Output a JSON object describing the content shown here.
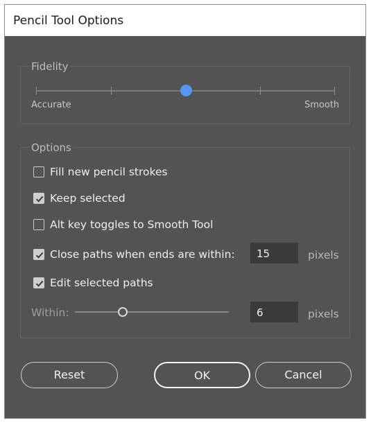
{
  "dialog": {
    "title": "Pencil Tool Options"
  },
  "fidelity": {
    "group_label": "Fidelity",
    "left_label": "Accurate",
    "right_label": "Smooth",
    "position_fraction": 0.5,
    "ticks": 5,
    "accent_color": "#5597ee"
  },
  "options": {
    "group_label": "Options",
    "fill_new": {
      "label": "Fill new pencil strokes",
      "checked": false
    },
    "keep_selected": {
      "label": "Keep selected",
      "checked": true
    },
    "alt_toggle": {
      "label": "Alt key toggles to Smooth Tool",
      "checked": false
    },
    "close_paths": {
      "label": "Close paths when ends are within:",
      "checked": true,
      "value": "15",
      "unit": "pixels"
    },
    "edit_selected": {
      "label": "Edit selected paths",
      "checked": true
    },
    "within": {
      "label": "Within:",
      "value": "6",
      "unit": "pixels",
      "slider_fraction": 0.3
    }
  },
  "buttons": {
    "reset": "Reset",
    "ok": "OK",
    "cancel": "Cancel"
  }
}
